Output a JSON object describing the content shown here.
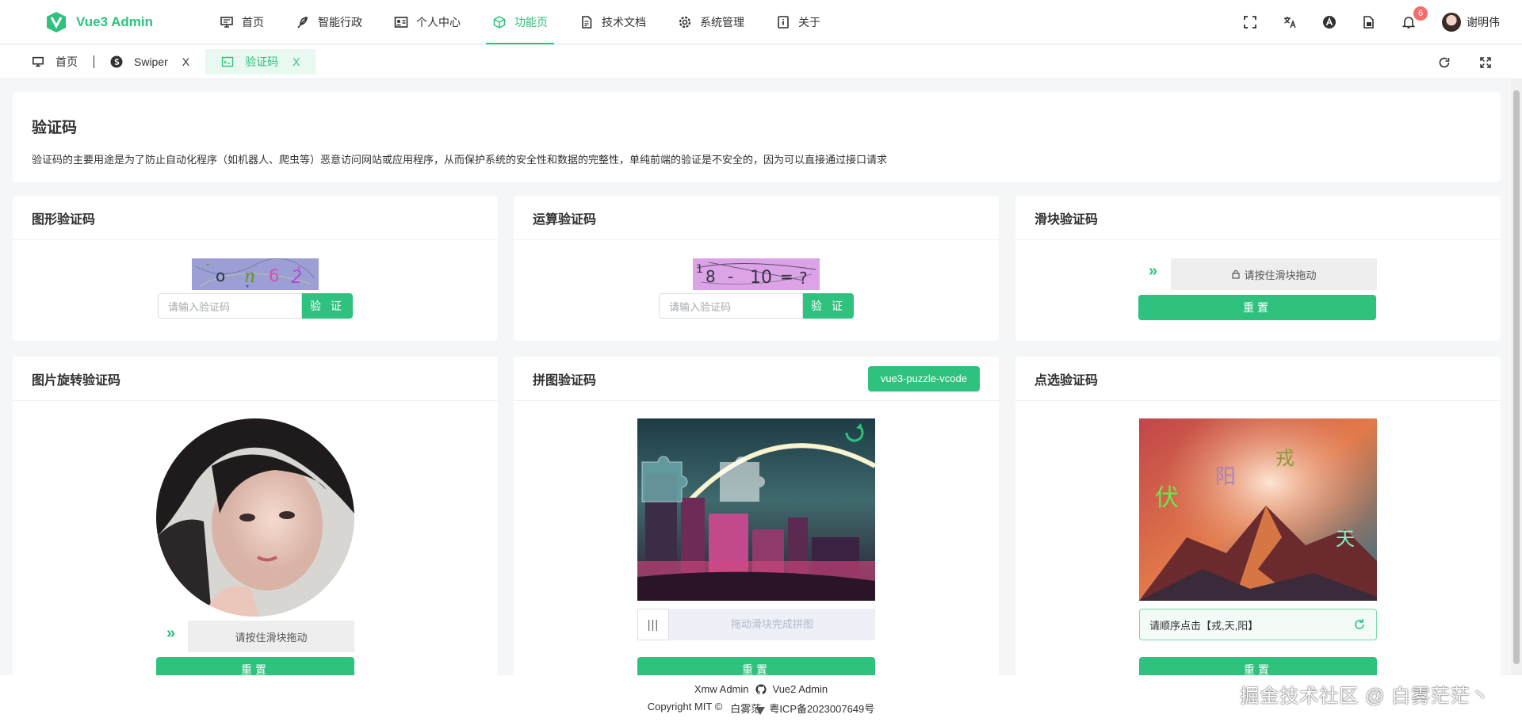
{
  "app": {
    "title": "Vue3 Admin"
  },
  "nav": {
    "items": [
      {
        "label": "首页"
      },
      {
        "label": "智能行政"
      },
      {
        "label": "个人中心"
      },
      {
        "label": "功能页"
      },
      {
        "label": "技术文档"
      },
      {
        "label": "系统管理"
      },
      {
        "label": "关于"
      }
    ],
    "active": "功能页"
  },
  "header": {
    "notification_count": "6",
    "user_name": "谢明伟"
  },
  "tabs": [
    {
      "label": "首页"
    },
    {
      "label": "Swiper",
      "close": "X"
    },
    {
      "label": "验证码",
      "close": "X",
      "active": true
    }
  ],
  "intro": {
    "title": "验证码",
    "description": "验证码的主要用途是为了防止自动化程序（如机器人、爬虫等）恶意访问网站或应用程序，从而保护系统的安全性和数据的完整性，单纯前端的验证是不安全的，因为可以直接通过接口请求"
  },
  "panels": {
    "graphic": {
      "title": "图形验证码",
      "captcha_text": [
        "o",
        "n",
        "6",
        "2"
      ],
      "placeholder": "请输入验证码",
      "button": "验 证"
    },
    "arith": {
      "title": "运算验证码",
      "captcha_text": [
        "1",
        "8",
        "-",
        "10",
        "=",
        "?"
      ],
      "placeholder": "请输入验证码",
      "button": "验 证"
    },
    "slider": {
      "title": "滑块验证码",
      "track_text": "请按住滑块拖动",
      "reset": "重置"
    },
    "rotate": {
      "title": "图片旋转验证码",
      "track_text": "请按住滑块拖动",
      "reset": "重置"
    },
    "puzzle": {
      "title": "拼图验证码",
      "tag": "vue3-puzzle-vcode",
      "track_text": "拖动滑块完成拼图",
      "reset": "重置"
    },
    "click": {
      "title": "点选验证码",
      "chars": [
        "伏",
        "阳",
        "戎",
        "天"
      ],
      "instruction": "请顺序点击【戎,天,阳】",
      "reset": "重置"
    }
  },
  "footer": {
    "links": [
      {
        "label": "Xmw Admin"
      },
      {
        "label": "Vue2 Admin"
      }
    ],
    "copyright": "Copyright MIT ©",
    "author": "白雾茫",
    "icp": "粤ICP备2023007649号"
  },
  "watermark": "掘金技术社区 @ 白雾茫茫丶",
  "colors": {
    "accent": "#2ec27e",
    "badge": "#f56c6c"
  }
}
